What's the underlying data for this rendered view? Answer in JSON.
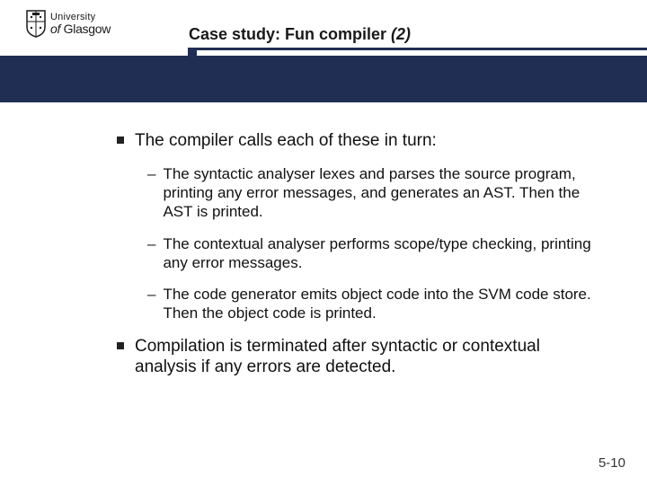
{
  "logo": {
    "line1": "University",
    "line2": "of Glasgow"
  },
  "title": {
    "prefix": "Case study: Fun compiler ",
    "suffix": "(2)"
  },
  "bullets": [
    {
      "text": "The compiler calls each of these in turn:",
      "subs": [
        "The syntactic analyser lexes and parses the source program, printing any error messages, and generates an AST. Then the AST is printed.",
        "The contextual analyser performs scope/type checking, printing any error messages.",
        "The code generator emits object code into the SVM code store. Then the object code is printed."
      ]
    },
    {
      "text": "Compilation is terminated after syntactic or contextual analysis if any errors are detected.",
      "subs": []
    }
  ],
  "page_number": "5-10"
}
